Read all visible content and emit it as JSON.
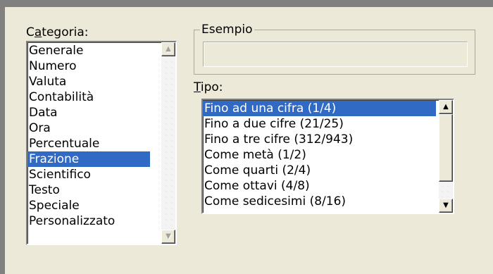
{
  "categoria": {
    "label_underlined": "a",
    "label_before": "C",
    "label_after": "tegoria:",
    "items": [
      "Generale",
      "Numero",
      "Valuta",
      "Contabilità",
      "Data",
      "Ora",
      "Percentuale",
      "Frazione",
      "Scientifico",
      "Testo",
      "Speciale",
      "Personalizzato"
    ],
    "selected": "Frazione"
  },
  "esempio": {
    "title": "Esempio",
    "value": ""
  },
  "tipo": {
    "label_underlined": "T",
    "label_after": "ipo:",
    "items": [
      "Fino ad una cifra  (1/4)",
      "Fino a due cifre (21/25)",
      "Fino a tre cifre (312/943)",
      "Come metà  (1/2)",
      "Come quarti  (2/4)",
      "Come ottavi  (4/8)",
      "Come sedicesimi  (8/16)"
    ],
    "selected": "Fino ad una cifra  (1/4)"
  },
  "colors": {
    "selection": "#316ac5",
    "dialog_bg": "#ece9d8"
  },
  "icons": {
    "scroll_up": "▲",
    "scroll_down": "▼"
  }
}
